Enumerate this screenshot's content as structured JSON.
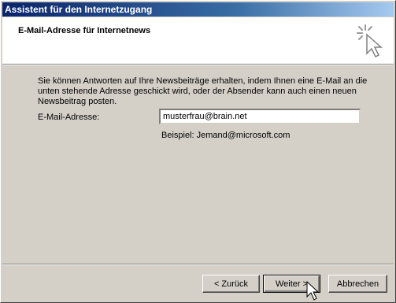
{
  "window": {
    "title": "Assistent für den Internetzugang"
  },
  "header": {
    "title": "E-Mail-Adresse für Internetnews",
    "icon": "wizard-sparkle-cursor-icon"
  },
  "content": {
    "description": "Sie können Antworten auf Ihre Newsbeiträge erhalten, indem Ihnen eine E-Mail an die unten stehende Adresse geschickt wird, oder der Absender kann auch einen neuen Newsbeitrag posten.",
    "email_label": "E-Mail-Adresse:",
    "email_value": "musterfrau@brain.net",
    "example": "Beispiel: Jemand@microsoft.com"
  },
  "buttons": {
    "back": "< Zurück",
    "next": "Weiter >",
    "cancel": "Abbrechen"
  }
}
